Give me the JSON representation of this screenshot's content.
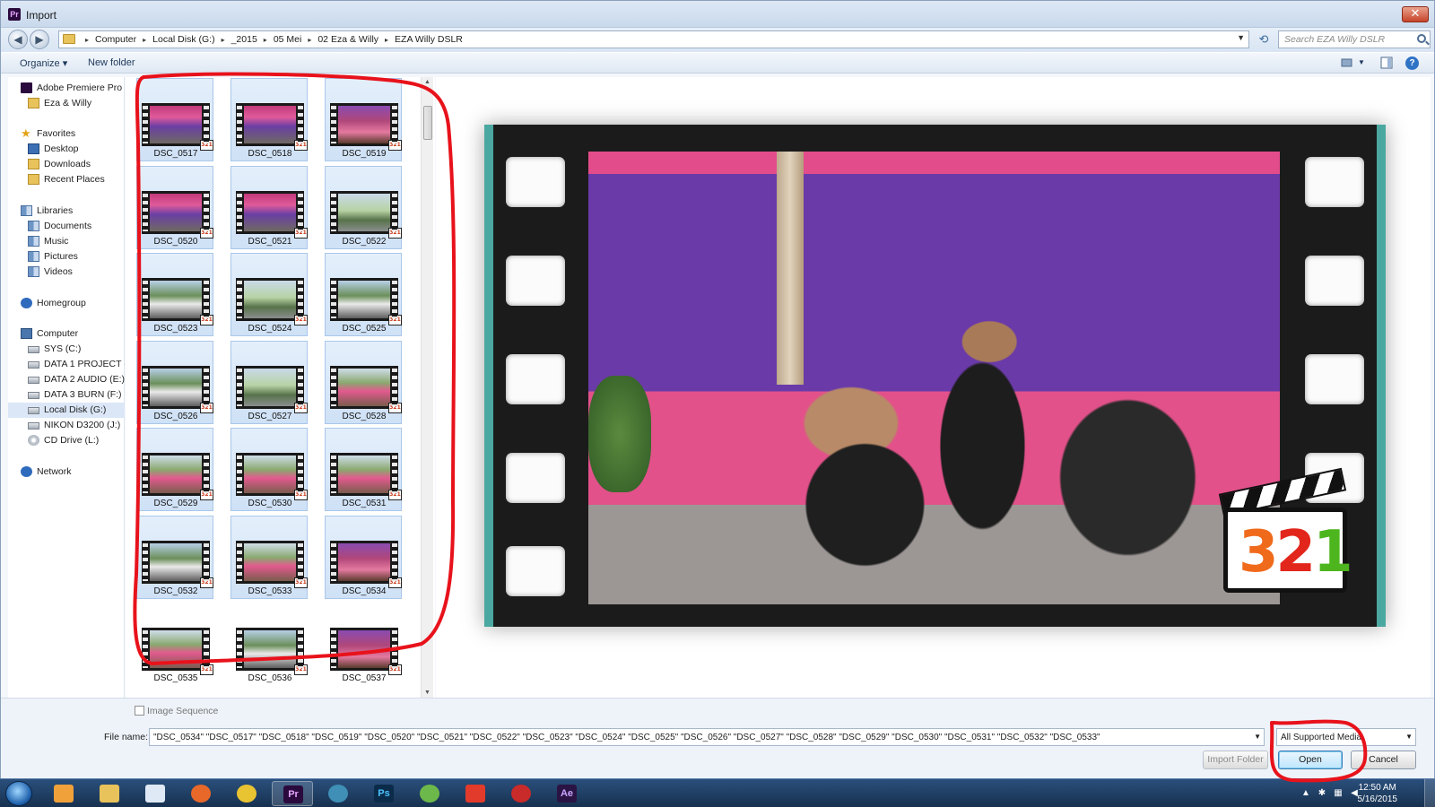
{
  "window": {
    "title": "Import"
  },
  "address": {
    "crumbs": [
      "Computer",
      "Local Disk (G:)",
      "_2015",
      "05 Mei",
      "02 Eza & Willy",
      "EZA Willy DSLR"
    ],
    "search_placeholder": "Search EZA Willy DSLR"
  },
  "toolbar": {
    "organize": "Organize ▾",
    "new_folder": "New folder"
  },
  "nav": {
    "items": [
      {
        "label": "Adobe Premiere Pro C",
        "icon": "premiere-icon"
      },
      {
        "label": "Eza & Willy",
        "icon": "folder-icon"
      },
      {
        "label": "Favorites",
        "icon": "star-icon"
      },
      {
        "label": "Desktop",
        "icon": "desktop-icon"
      },
      {
        "label": "Downloads",
        "icon": "downloads-icon"
      },
      {
        "label": "Recent Places",
        "icon": "recent-places-icon"
      },
      {
        "label": "Libraries",
        "icon": "libraries-icon"
      },
      {
        "label": "Documents",
        "icon": "documents-icon"
      },
      {
        "label": "Music",
        "icon": "music-icon"
      },
      {
        "label": "Pictures",
        "icon": "pictures-icon"
      },
      {
        "label": "Videos",
        "icon": "videos-icon"
      },
      {
        "label": "Homegroup",
        "icon": "homegroup-icon"
      },
      {
        "label": "Computer",
        "icon": "computer-icon"
      },
      {
        "label": "SYS (C:)",
        "icon": "drive-icon"
      },
      {
        "label": "DATA 1 PROJECT (D",
        "icon": "drive-icon"
      },
      {
        "label": "DATA 2 AUDIO (E:)",
        "icon": "drive-icon"
      },
      {
        "label": "DATA 3 BURN (F:)",
        "icon": "drive-icon"
      },
      {
        "label": "Local Disk (G:)",
        "icon": "drive-icon",
        "selected": true
      },
      {
        "label": "NIKON D3200 (J:)",
        "icon": "drive-icon"
      },
      {
        "label": "CD Drive (L:)",
        "icon": "cd-drive-icon"
      },
      {
        "label": "Network",
        "icon": "network-icon"
      }
    ]
  },
  "files": [
    {
      "name": "DSC_0517",
      "selected": true
    },
    {
      "name": "DSC_0518",
      "selected": true
    },
    {
      "name": "DSC_0519",
      "selected": true
    },
    {
      "name": "DSC_0520",
      "selected": true
    },
    {
      "name": "DSC_0521",
      "selected": true
    },
    {
      "name": "DSC_0522",
      "selected": true
    },
    {
      "name": "DSC_0523",
      "selected": true
    },
    {
      "name": "DSC_0524",
      "selected": true
    },
    {
      "name": "DSC_0525",
      "selected": true
    },
    {
      "name": "DSC_0526",
      "selected": true
    },
    {
      "name": "DSC_0527",
      "selected": true
    },
    {
      "name": "DSC_0528",
      "selected": true
    },
    {
      "name": "DSC_0529",
      "selected": true
    },
    {
      "name": "DSC_0530",
      "selected": true
    },
    {
      "name": "DSC_0531",
      "selected": true
    },
    {
      "name": "DSC_0532",
      "selected": true
    },
    {
      "name": "DSC_0533",
      "selected": true
    },
    {
      "name": "DSC_0534",
      "selected": true
    },
    {
      "name": "DSC_0535",
      "selected": false
    },
    {
      "name": "DSC_0536",
      "selected": false
    },
    {
      "name": "DSC_0537",
      "selected": false
    }
  ],
  "preview": {
    "badge_text": "321"
  },
  "bottom": {
    "image_sequence_label": "Image Sequence",
    "file_name_label": "File name:",
    "file_name_value": "\"DSC_0534\" \"DSC_0517\" \"DSC_0518\" \"DSC_0519\" \"DSC_0520\" \"DSC_0521\" \"DSC_0522\" \"DSC_0523\" \"DSC_0524\" \"DSC_0525\" \"DSC_0526\" \"DSC_0527\" \"DSC_0528\" \"DSC_0529\" \"DSC_0530\" \"DSC_0531\" \"DSC_0532\" \"DSC_0533\"",
    "file_type": "All Supported Media",
    "import_folder": "Import Folder",
    "open": "Open",
    "cancel": "Cancel"
  },
  "taskbar": {
    "apps": [
      {
        "name": "media-player-icon",
        "label": ""
      },
      {
        "name": "explorer-icon",
        "label": ""
      },
      {
        "name": "notepad-icon",
        "label": ""
      },
      {
        "name": "firefox-icon",
        "label": ""
      },
      {
        "name": "chrome-icon",
        "label": ""
      },
      {
        "name": "premiere-icon",
        "label": "Pr",
        "active": true
      },
      {
        "name": "disc-app-icon",
        "label": ""
      },
      {
        "name": "photoshop-icon",
        "label": "Ps"
      },
      {
        "name": "globe-app-icon",
        "label": ""
      },
      {
        "name": "swirl-app-icon",
        "label": ""
      },
      {
        "name": "red-app-icon",
        "label": ""
      },
      {
        "name": "after-effects-icon",
        "label": "Ae"
      }
    ],
    "time": "12:50 AM",
    "date": "5/16/2015"
  },
  "colors": {
    "annotation_red": "#e8121b",
    "selection_blue": "#cfe1f6",
    "taskbar": "#1f3e63"
  }
}
